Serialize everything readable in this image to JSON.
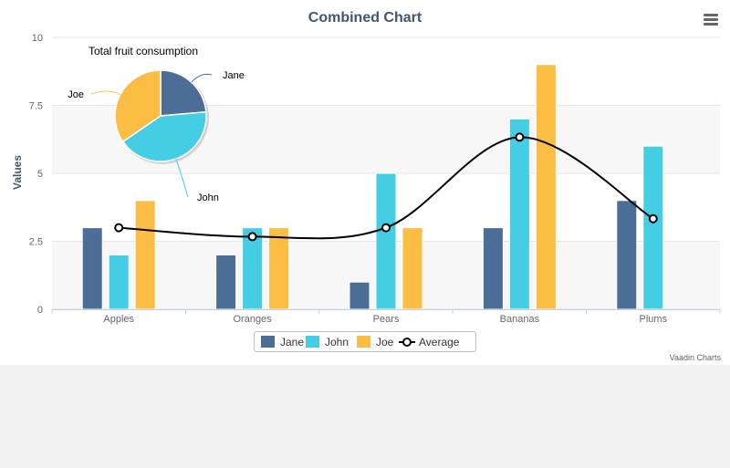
{
  "chart_data": {
    "type": "bar",
    "title": "Combined Chart",
    "ylabel": "Values",
    "xlabel": "",
    "ylim": [
      0,
      10
    ],
    "yticks": [
      "0",
      "2.5",
      "5",
      "7.5",
      "10"
    ],
    "categories": [
      "Apples",
      "Oranges",
      "Pears",
      "Bananas",
      "Plums"
    ],
    "grid": true,
    "legend_position": "bottom-center",
    "series": [
      {
        "name": "Jane",
        "type": "bar",
        "color": "#4b6d96",
        "values": [
          3,
          2,
          1,
          3,
          4
        ]
      },
      {
        "name": "John",
        "type": "bar",
        "color": "#46cde6",
        "values": [
          2,
          3,
          5,
          7,
          6
        ]
      },
      {
        "name": "Joe",
        "type": "bar",
        "color": "#fbbd43",
        "values": [
          4,
          3,
          3,
          9,
          0
        ]
      },
      {
        "name": "Average",
        "type": "spline",
        "color": "#000000",
        "values": [
          3,
          2.67,
          3,
          6.33,
          3.33
        ]
      }
    ],
    "pie": {
      "title": "Total fruit consumption",
      "slices": [
        {
          "name": "Jane",
          "value": 13,
          "color": "#4b6d96"
        },
        {
          "name": "John",
          "value": 23,
          "color": "#46cde6"
        },
        {
          "name": "Joe",
          "value": 19,
          "color": "#fbbd43"
        }
      ]
    }
  },
  "credits": "Vaadin Charts",
  "colors": {
    "title": "#3e576f",
    "axis_label": "#666666",
    "grid": "#e6e6e6",
    "band": "#f7f7f7"
  }
}
